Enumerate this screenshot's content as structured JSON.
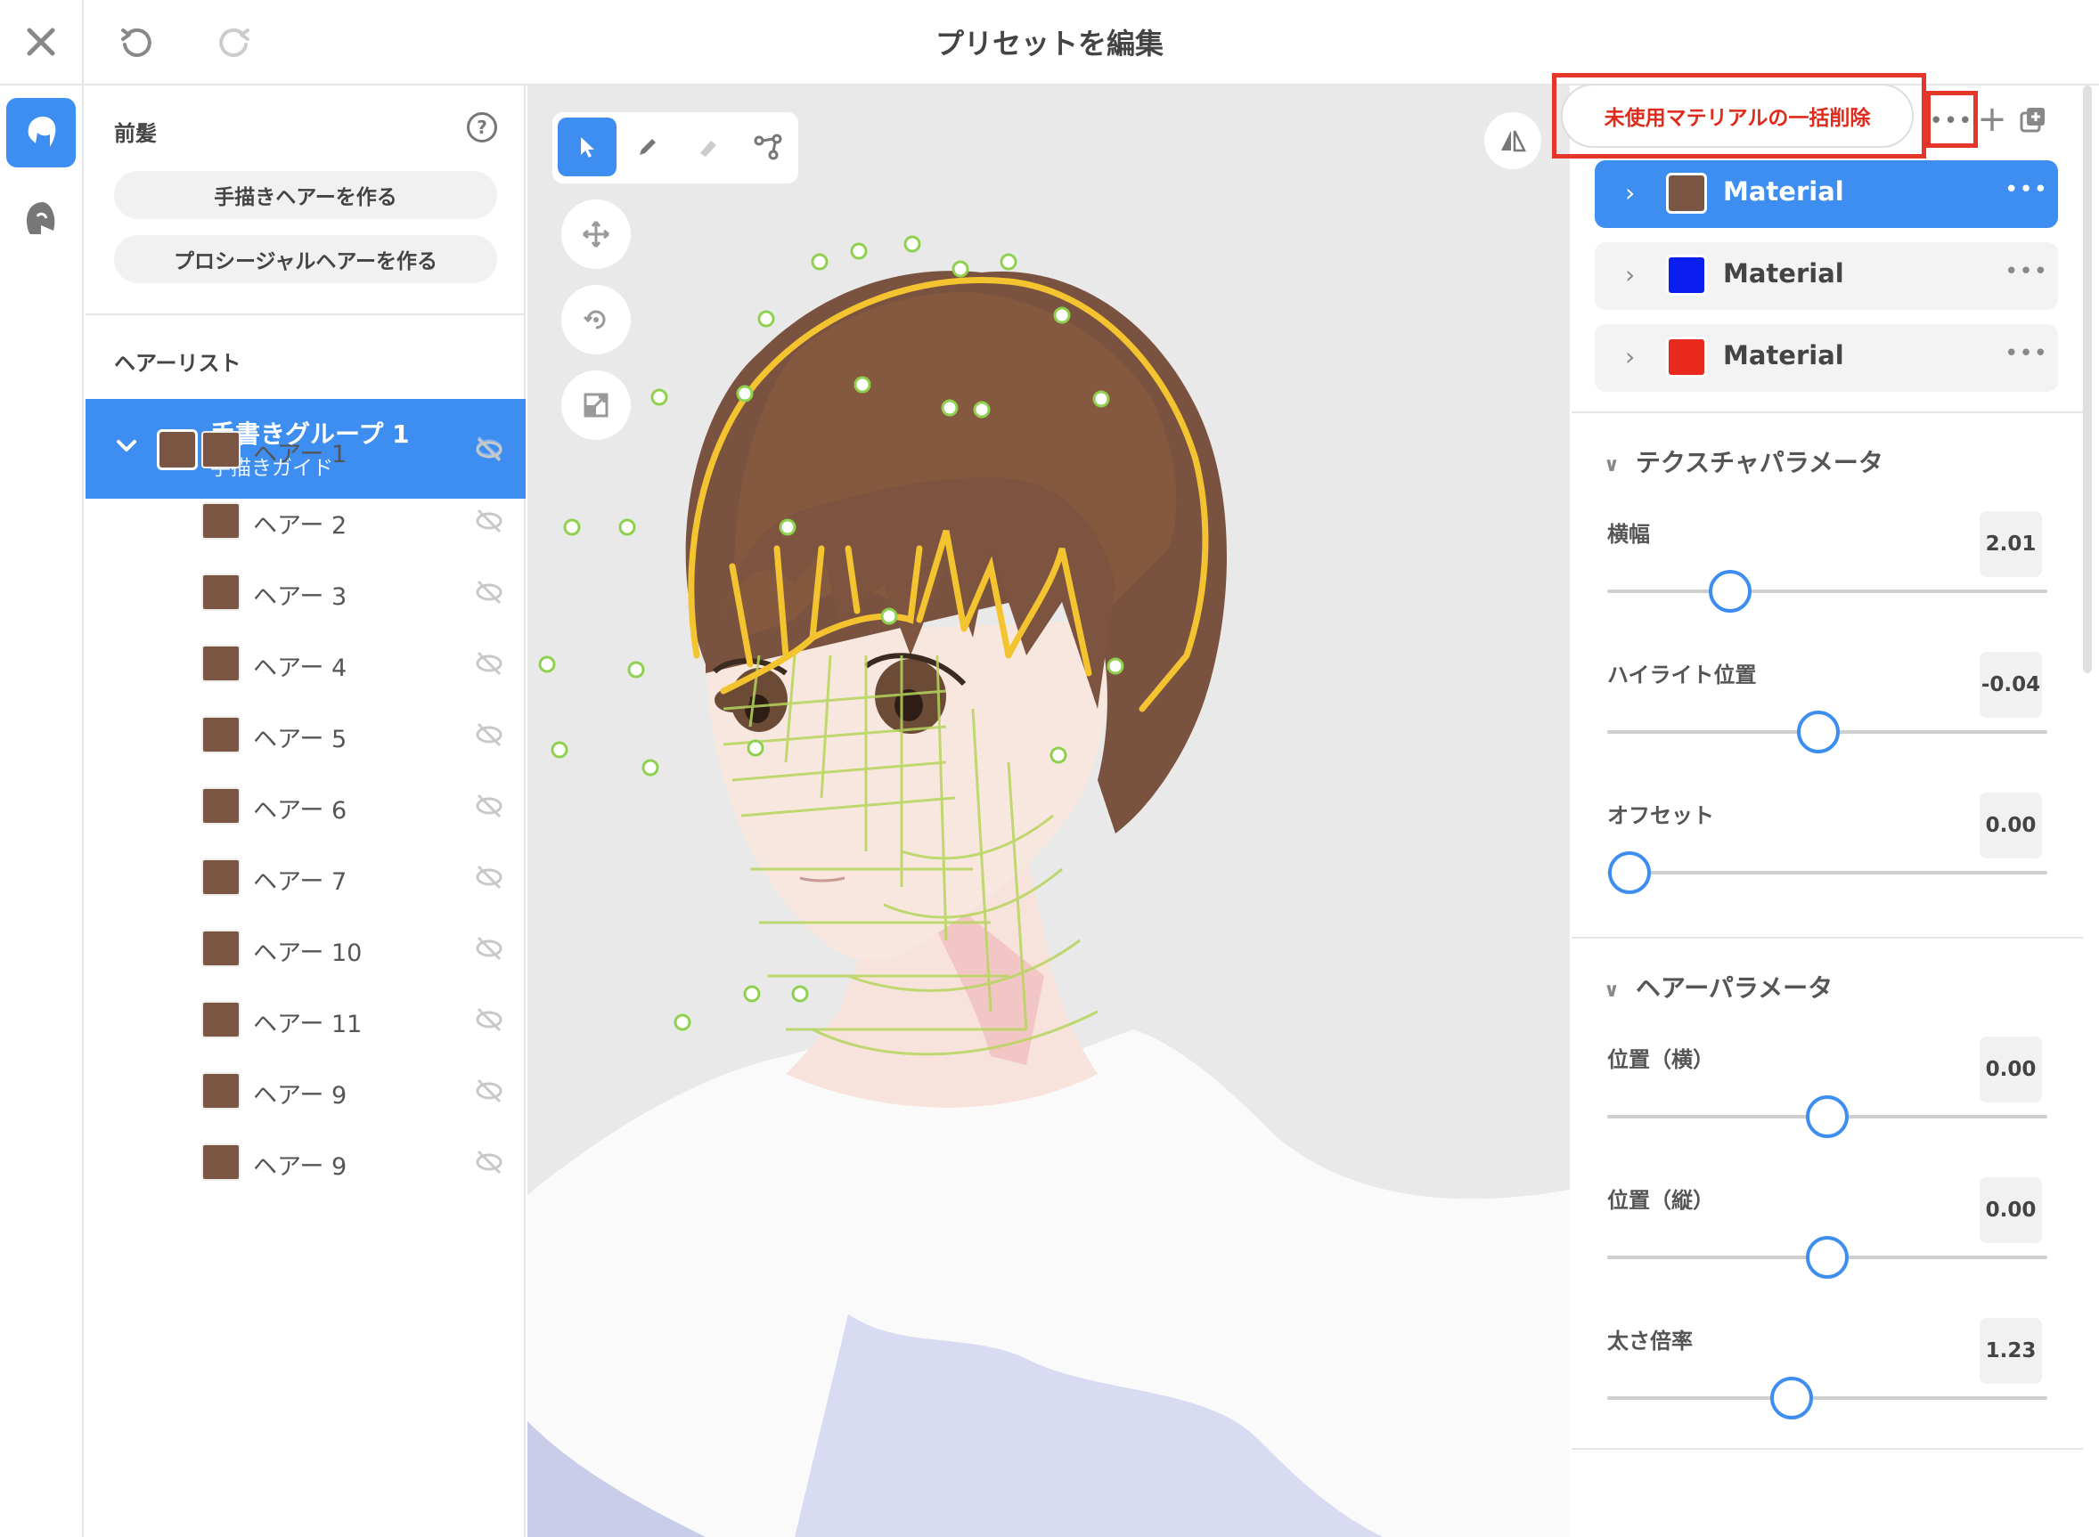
{
  "topbar": {
    "title": "プリセットを編集"
  },
  "rail": {
    "items": [
      {
        "icon": "hair-front-icon",
        "active": true
      },
      {
        "icon": "hair-back-icon",
        "active": false
      }
    ]
  },
  "left_panel": {
    "title": "前髪",
    "btn_handdrawn": "手描きヘアーを作る",
    "btn_procedural": "プロシージャルヘアーを作る",
    "list_heading": "ヘアーリスト",
    "group": {
      "name": "手書きグループ 1",
      "subtitle": "手描きガイド",
      "color": "#7a5643"
    },
    "hairs": [
      {
        "label": "ヘアー 1"
      },
      {
        "label": "ヘアー 2"
      },
      {
        "label": "ヘアー 3"
      },
      {
        "label": "ヘアー 4"
      },
      {
        "label": "ヘアー 5"
      },
      {
        "label": "ヘアー 6"
      },
      {
        "label": "ヘアー 7"
      },
      {
        "label": "ヘアー 10"
      },
      {
        "label": "ヘアー 11"
      },
      {
        "label": "ヘアー 9"
      },
      {
        "label": "ヘアー 9"
      }
    ]
  },
  "viewport": {
    "tools": [
      "select-icon",
      "pen-icon",
      "eraser-icon",
      "path-icon"
    ],
    "active_tool": "select-icon",
    "round_tools": [
      "move-icon",
      "rotate-icon",
      "scale-icon"
    ]
  },
  "right_panel": {
    "delete_unused_label": "未使用マテリアルの一括削除",
    "materials": [
      {
        "name": "Material",
        "color": "#7a5643",
        "active": true
      },
      {
        "name": "Material",
        "color": "#0a1ef0",
        "active": false
      },
      {
        "name": "Material",
        "color": "#e8291c",
        "active": false
      }
    ],
    "texture_section": {
      "title": "テクスチャパラメータ",
      "params": [
        {
          "label": "横幅",
          "value": "2.01",
          "fraction": 0.28
        },
        {
          "label": "ハイライト位置",
          "value": "-0.04",
          "fraction": 0.48
        },
        {
          "label": "オフセット",
          "value": "0.00",
          "fraction": 0.05
        }
      ]
    },
    "hair_section": {
      "title": "ヘアーパラメータ",
      "params": [
        {
          "label": "位置（横）",
          "value": "0.00",
          "fraction": 0.5
        },
        {
          "label": "位置（縦）",
          "value": "0.00",
          "fraction": 0.5
        },
        {
          "label": "太さ倍率",
          "value": "1.23",
          "fraction": 0.42
        }
      ]
    }
  },
  "colors": {
    "accent": "#3d8ef0",
    "highlight_red": "#e5362a",
    "hair_brown": "#7a5643"
  }
}
